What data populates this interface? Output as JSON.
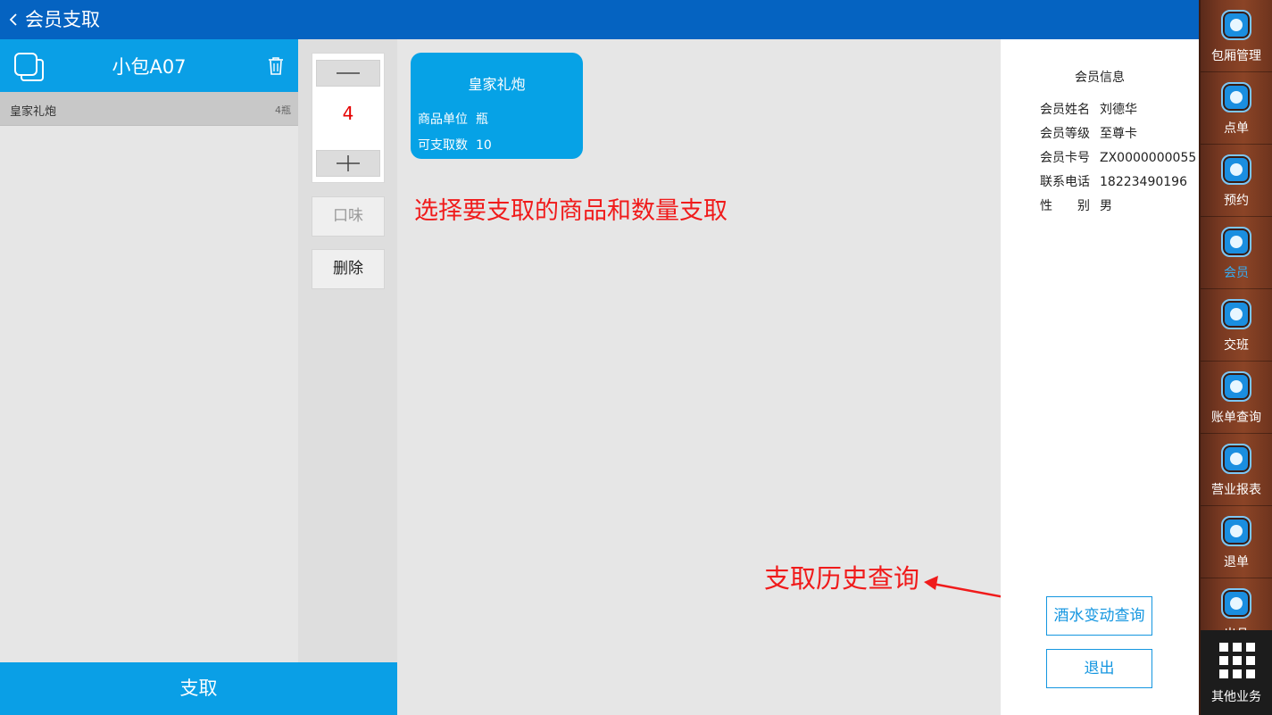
{
  "header": {
    "title": "会员支取"
  },
  "room": {
    "name": "小包A07"
  },
  "order": {
    "items": [
      {
        "name": "皇家礼炮",
        "qty": "4瓶"
      }
    ]
  },
  "stepper": {
    "count": "4"
  },
  "actions": {
    "flavor": "口味",
    "delete": "删除",
    "withdraw": "支取"
  },
  "product": {
    "name": "皇家礼炮",
    "unit_label": "商品单位",
    "unit": "瓶",
    "avail_label": "可支取数",
    "avail": "10"
  },
  "hints": {
    "select": "选择要支取的商品和数量支取",
    "history": "支取历史查询"
  },
  "member": {
    "heading": "会员信息",
    "rows": [
      {
        "k": "会员姓名",
        "v": "刘德华"
      },
      {
        "k": "会员等级",
        "v": "至尊卡"
      },
      {
        "k": "会员卡号",
        "v": "ZX0000000055"
      },
      {
        "k": "联系电话",
        "v": "18223490196"
      },
      {
        "k": "性　　别",
        "v": "男"
      }
    ],
    "history_button": "酒水变动查询",
    "exit_button": "退出"
  },
  "nav": {
    "items": [
      {
        "label": "包厢管理",
        "icon": "grid-icon"
      },
      {
        "label": "点单",
        "icon": "cocktail-icon"
      },
      {
        "label": "预约",
        "icon": "clock-icon"
      },
      {
        "label": "会员",
        "icon": "member-icon"
      },
      {
        "label": "交班",
        "icon": "handover-icon"
      },
      {
        "label": "账单查询",
        "icon": "bill-search-icon"
      },
      {
        "label": "营业报表",
        "icon": "report-icon"
      },
      {
        "label": "退单",
        "icon": "refund-icon"
      },
      {
        "label": "出品",
        "icon": "export-icon"
      }
    ],
    "more": "其他业务",
    "active_color": "#35aef5"
  },
  "colors": {
    "accent": "#0a9fe6",
    "topbar": "#0563c1",
    "hint": "#f01b1b",
    "count": "#e60000"
  }
}
